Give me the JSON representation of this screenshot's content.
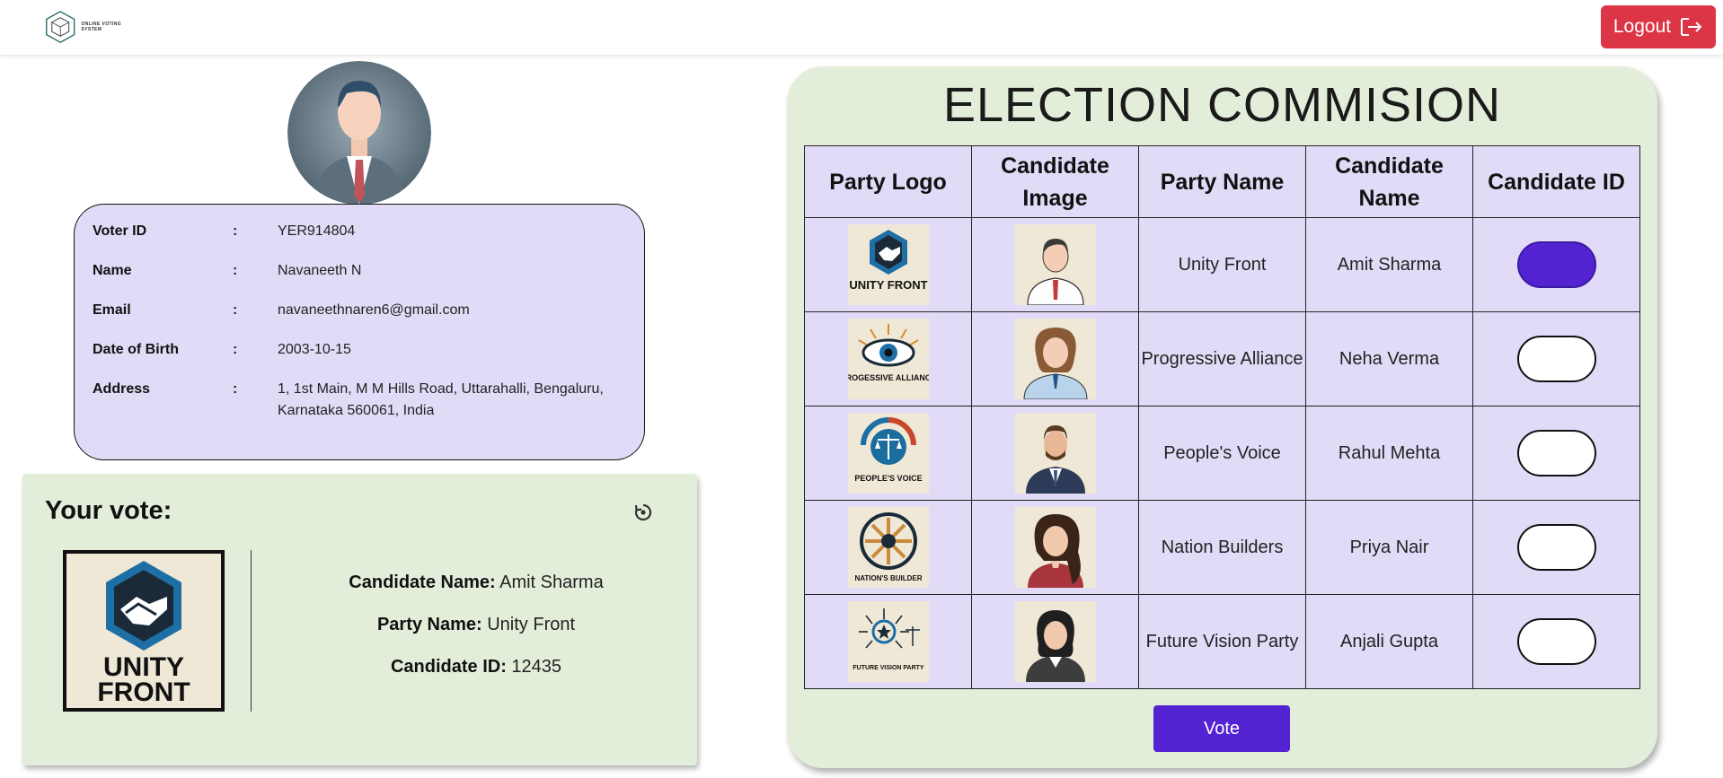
{
  "header": {
    "logo_text": "ONLINE VOTING SYSTEM",
    "logout_label": "Logout"
  },
  "voter": {
    "fields": [
      {
        "label": "Voter ID",
        "colon": ":",
        "value": "YER914804"
      },
      {
        "label": "Name",
        "colon": ":",
        "value": "Navaneeth N"
      },
      {
        "label": "Email",
        "colon": ":",
        "value": "navaneethnaren6@gmail.com"
      },
      {
        "label": "Date of Birth",
        "colon": ":",
        "value": "2003-10-15"
      },
      {
        "label": "Address",
        "colon": ":",
        "value": "1, 1st Main, M M Hills Road, Uttarahalli, Bengaluru, Karnataka 560061, India"
      }
    ]
  },
  "your_vote": {
    "title": "Your vote:",
    "logo_text_1": "UNITY",
    "logo_text_2": "FRONT",
    "candidate_name_label": "Candidate Name:",
    "candidate_name": "Amit Sharma",
    "party_name_label": "Party Name:",
    "party_name": "Unity Front",
    "candidate_id_label": "Candidate ID:",
    "candidate_id": "12435"
  },
  "election": {
    "title": "ELECTION COMMISION",
    "headers": [
      "Party Logo",
      "Candidate Image",
      "Party Name",
      "Candidate Name",
      "Candidate ID"
    ],
    "rows": [
      {
        "logo_text": "UNITY FRONT",
        "party": "Unity Front",
        "candidate": "Amit Sharma",
        "selected": true
      },
      {
        "logo_text": "PROGESSIVE ALLIANCE",
        "party": "Progressive Alliance",
        "candidate": "Neha Verma",
        "selected": false
      },
      {
        "logo_text": "PEOPLE'S VOICE",
        "party": "People's Voice",
        "candidate": "Rahul Mehta",
        "selected": false
      },
      {
        "logo_text": "NATION'S BUILDER",
        "party": "Nation Builders",
        "candidate": "Priya Nair",
        "selected": false
      },
      {
        "logo_text": "FUTURE VISION PARTY",
        "party": "Future Vision Party",
        "candidate": "Anjali Gupta",
        "selected": false
      }
    ],
    "vote_label": "Vote"
  },
  "colors": {
    "logout": "#dc3545",
    "accent": "#5423d1",
    "card_purple": "#e2dbf7",
    "card_green": "#e3eeda"
  }
}
